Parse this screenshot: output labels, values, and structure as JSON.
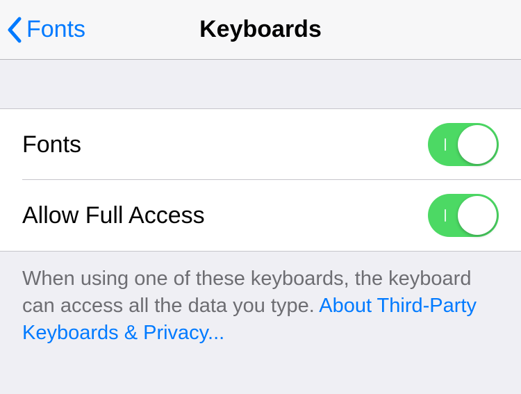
{
  "nav": {
    "back_label": "Fonts",
    "title": "Keyboards"
  },
  "rows": [
    {
      "label": "Fonts",
      "toggle_on": true
    },
    {
      "label": "Allow Full Access",
      "toggle_on": true
    }
  ],
  "footer": {
    "text": "When using one of these keyboards, the keyboard can access all the data you type.",
    "link_text": "About Third-Party Keyboards & Privacy..."
  }
}
